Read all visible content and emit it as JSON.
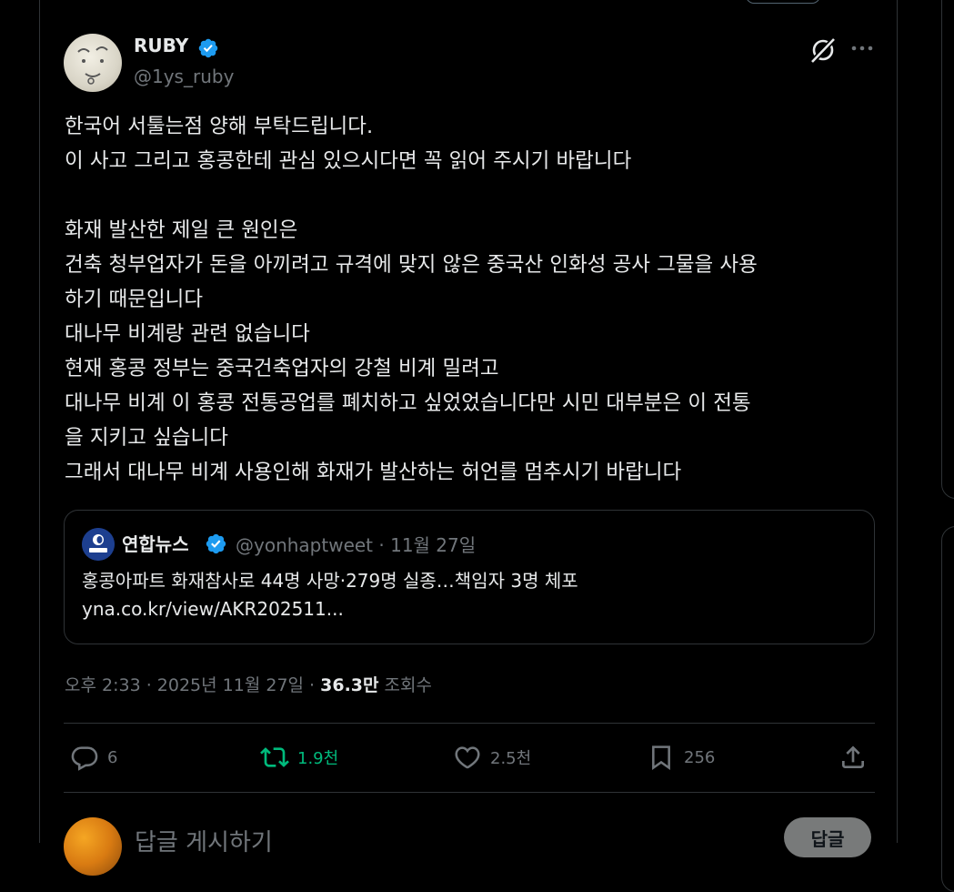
{
  "author": {
    "name": "RUBY",
    "handle": "@1ys_ruby"
  },
  "tweet": {
    "lines": [
      "한국어 서툴는점 양해 부탁드립니다.",
      "이 사고 그리고 홍콩한테 관심 있으시다면 꼭 읽어 주시기 바랍니다",
      "",
      "화재 발산한 제일 큰 원인은",
      "건축 청부업자가 돈을 아끼려고 규격에 맞지 않은 중국산 인화성 공사 그물을 사용",
      "하기 때문입니다",
      "대나무 비계랑 관련 없습니다",
      "현재 홍콩 정부는 중국건축업자의 강철 비계 밀려고",
      "대나무 비계 이 홍콩 전통공업를 폐치하고 싶었었습니다만 시민 대부분은 이 전통",
      "을 지키고 싶습니다",
      "그래서 대나무 비계 사용인해 화재가 발산하는 허언를 멈추시기 바랍니다"
    ]
  },
  "quote": {
    "name": "연합뉴스",
    "meta": "@yonhaptweet · 11월 27일",
    "text": "홍콩아파트 화재참사로 44명 사망·279명 실종…책임자 3명 체포",
    "link": "yna.co.kr/view/AKR202511..."
  },
  "meta": {
    "time": "오후 2:33 · 2025년 11월 27일 · ",
    "views_count": "36.3만",
    "views_label": " 조회수"
  },
  "actions": {
    "replies": "6",
    "reposts": "1.9천",
    "likes": "2.5천",
    "bookmarks": "256"
  },
  "reply_box": {
    "placeholder": "답글 게시하기",
    "button": "답글"
  },
  "colors": {
    "background": "#000000",
    "text": "#e7e9ea",
    "muted": "#71767b",
    "verified": "#1d9bf0",
    "repost": "#00ba7c",
    "border": "#2f3336"
  },
  "icons": {
    "verified": "verified-badge-icon",
    "grok": "grok-icon",
    "more": "more-dots-icon",
    "reply": "reply-bubble-icon",
    "repost": "repost-icon",
    "like": "heart-icon",
    "bookmark": "bookmark-icon",
    "share": "share-icon"
  }
}
